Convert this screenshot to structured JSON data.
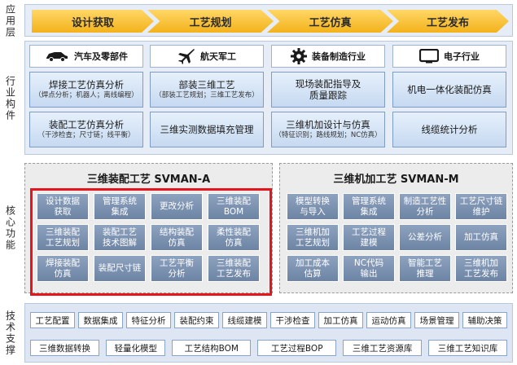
{
  "layers": {
    "app": "应用层",
    "industry": "行业构件",
    "core": "核心功能",
    "tech": "技术支撑"
  },
  "app_steps": [
    "设计获取",
    "工艺规划",
    "工艺仿真",
    "工艺发布"
  ],
  "industries": [
    {
      "name": "汽车及零部件",
      "icon": "car-icon",
      "cards": [
        {
          "main": "焊接工艺仿真分析",
          "sub": "（焊点分析；机器人；离线编程）"
        },
        {
          "main": "装配工艺仿真分析",
          "sub": "（干涉检查；尺寸链；线平衡）"
        }
      ]
    },
    {
      "name": "航天军工",
      "icon": "airplane-icon",
      "cards": [
        {
          "main": "部装三维工艺",
          "sub": "（部装工艺规划；三维工艺发布）"
        },
        {
          "main": "三维实测数据填充管理",
          "sub": ""
        }
      ]
    },
    {
      "name": "装备制造行业",
      "icon": "gear-icon",
      "cards": [
        {
          "main": "现场装配指导及\n质量跟踪",
          "sub": ""
        },
        {
          "main": "三维机加设计与仿真",
          "sub": "（特征识别；路线规划；NC仿真）"
        }
      ]
    },
    {
      "name": "电子行业",
      "icon": "monitor-icon",
      "cards": [
        {
          "main": "机电一体化装配仿真",
          "sub": ""
        },
        {
          "main": "线缆统计分析",
          "sub": ""
        }
      ]
    }
  ],
  "core": {
    "assembly": {
      "title": "三维装配工艺  SVMAN-A",
      "cells": [
        "设计数据\n获取",
        "管理系统\n集成",
        "更改分析",
        "三维装配\nBOM",
        "三维装配\n工艺规划",
        "装配工艺\n技术图解",
        "结构装配\n仿真",
        "柔性装配\n仿真",
        "焊接装配\n仿真",
        "装配尺寸链",
        "工艺平衡\n分析",
        "三维装配\n工艺发布"
      ]
    },
    "machining": {
      "title": "三维机加工艺  SVMAN-M",
      "cells": [
        "模型转换\n与导入",
        "管理系统\n集成",
        "制造工艺性\n分析",
        "工艺尺寸链\n维护",
        "三维机加\n工艺规划",
        "工艺过程\n建模",
        "公差分析",
        "加工仿真",
        "加工成本\n估算",
        "NC代码\n输出",
        "智能工艺\n推理",
        "三维机加\n工艺发布"
      ]
    }
  },
  "tech_row1": [
    "工艺配置",
    "数据集成",
    "特征分析",
    "装配约束",
    "线缆建模",
    "干涉检查",
    "加工仿真",
    "运动仿真",
    "场景管理",
    "辅助决策"
  ],
  "tech_row2": [
    "三维数据转换",
    "轻量化模型",
    "工艺结构BOM",
    "工艺过程BOP",
    "三维工艺资源库",
    "三维工艺知识库"
  ],
  "colors": {
    "chevron": "#f3b21b",
    "highlight_frame": "#e8141b",
    "cell": "#7b90ad",
    "card": "#c6d9f1"
  }
}
